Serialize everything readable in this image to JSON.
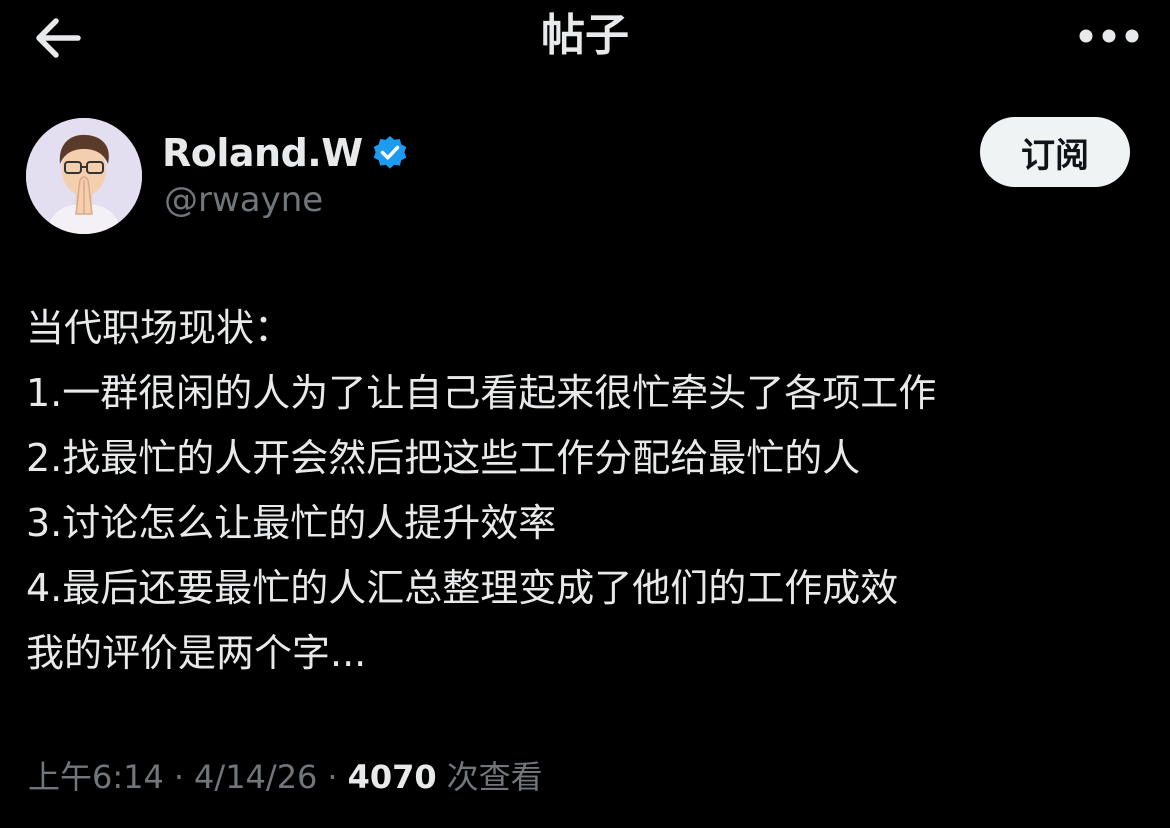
{
  "header": {
    "title": "帖子",
    "back_icon": "arrow-left-icon",
    "more_icon": "more-horizontal-icon"
  },
  "author": {
    "display_name": "Roland.W",
    "handle": "@rwayne",
    "verified": true,
    "verified_color": "#1d9bf0",
    "subscribe_label": "订阅"
  },
  "post": {
    "lines": [
      "当代职场现状：",
      "1.一群很闲的人为了让自己看起来很忙牵头了各项工作",
      "2.找最忙的人开会然后把这些工作分配给最忙的人",
      "3.讨论怎么让最忙的人提升效率",
      "4.最后还要最忙的人汇总整理变成了他们的工作成效",
      "我的评价是两个字..."
    ]
  },
  "meta": {
    "time": "上午6:14",
    "separator": "·",
    "date": "4/14/26",
    "views_count": "4070",
    "views_label": "次查看"
  },
  "colors": {
    "background": "#000000",
    "primary_text": "#e7e9ea",
    "secondary_text": "#71767b",
    "button_bg": "#eff3f4"
  }
}
